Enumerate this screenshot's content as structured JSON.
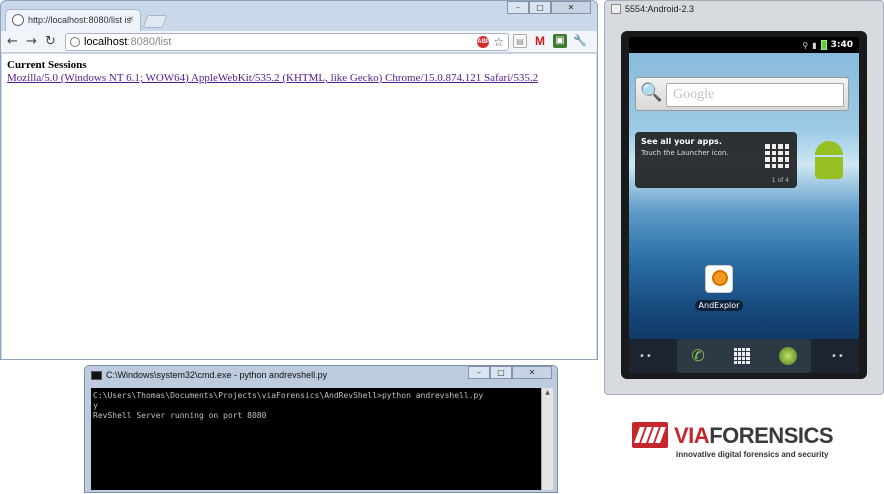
{
  "browser": {
    "tab_title": "http://localhost:8080/list is",
    "tab_close": "×",
    "window_controls": [
      "–",
      "□",
      "✕"
    ],
    "url_host": "localhost",
    "url_rest": ":8080/list",
    "page": {
      "heading": "Current Sessions",
      "sessions": [
        "Mozilla/5.0 (Windows NT 6.1; WOW64) AppleWebKit/535.2 (KHTML, like Gecko) Chrome/15.0.874.121 Safari/535.2"
      ]
    }
  },
  "cmd": {
    "title": "C:\\Windows\\system32\\cmd.exe - python  andrevshell.py",
    "window_controls": [
      "–",
      "□",
      "✕"
    ],
    "lines": [
      "C:\\Users\\Thomas\\Documents\\Projects\\viaForensics\\AndRevShell>python andrevshell.py",
      "y",
      "RevShell Server running on port 8080"
    ]
  },
  "emulator": {
    "title": "5554:Android-2.3",
    "time": "3:40",
    "search_placeholder": "Google",
    "tip_title": "See all your apps.",
    "tip_text": "Touch the Launcher icon.",
    "tip_count": "1 of 4",
    "app_label": "AndExplor"
  },
  "logo": {
    "via": "VIA",
    "forensics": "FORENSICS",
    "tagline": "innovative digital forensics and security"
  }
}
